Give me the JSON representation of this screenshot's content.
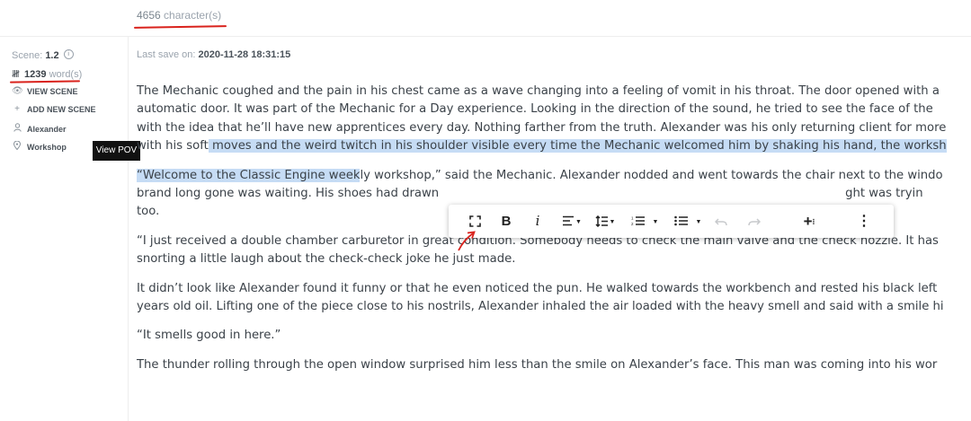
{
  "top": {
    "char_count": "4656",
    "char_label": "character(s)"
  },
  "sidebar": {
    "scene_label": "Scene:",
    "scene_value": "1.2",
    "word_count": "1239",
    "word_label": "word(s)",
    "items": [
      {
        "label": "VIEW SCENE",
        "icon": "eye-icon"
      },
      {
        "label": "ADD NEW SCENE",
        "icon": "plus-icon"
      },
      {
        "label": "Alexander",
        "icon": "user-icon"
      },
      {
        "label": "Workshop",
        "icon": "location-pin-icon"
      }
    ],
    "tooltip": "View POV"
  },
  "editor": {
    "last_save_label": "Last save on:",
    "last_save_value": "2020-11-28 18:31:15",
    "p1": {
      "l1": " The Mechanic coughed and the pain in his chest came as a wave changing into a feeling of vomit in his throat. The door opened with a",
      "l2": "automatic door. It was part of the Mechanic for a Day experience. Looking in the direction of the sound, he tried to see the face of the",
      "l3": "with the idea that he’ll have new apprentices every day. Nothing farther from the truth. Alexander was his only returning client for more",
      "l4a": "with his soft",
      "l4b": " moves and the weird twitch in his shoulder visible every time the Mechanic welcomed him by shaking his hand, the worksh"
    },
    "p2": {
      "l1a": "“Welcome to the Classic Engine week",
      "l1b": "ly workshop,” said the Mechanic. Alexander nodded and went towards the chair next to the windo",
      "l2a": "brand long gone was waiting. His shoes had drawn",
      "l2b": "ght was tryin",
      "l3": "too."
    },
    "p3": {
      "l1": "“I just received a double chamber carburetor in great condition. Somebody needs to check the main valve and the check nozzle. It has",
      "l2": "snorting a little laugh about the check-check joke he just made."
    },
    "p4": {
      "l1": "It didn’t look like Alexander found it funny or that he even noticed the pun. He walked towards the workbench and rested his black left",
      "l2": "years old oil. Lifting one of the piece close to his nostrils, Alexander inhaled the air loaded with the heavy smell and said with a smile hi"
    },
    "p5": {
      "l1": "“It smells good in here.”"
    },
    "p6": {
      "l1": "The thunder rolling through the open window surprised him less than the smile on Alexander’s face. This man was coming into his wor"
    }
  },
  "toolbar": {
    "fullscreen_icon": "fullscreen-icon",
    "bold": "B",
    "italic": "i",
    "align_icon": "align-left-icon",
    "line_height_icon": "line-height-icon",
    "numbered_list_icon": "numbered-list-icon",
    "bullet_list_icon": "bullet-list-icon",
    "undo_icon": "undo-icon",
    "redo_icon": "redo-icon",
    "insert_icon": "insert-plus-icon",
    "more_icon": "more-vertical-icon"
  },
  "colors": {
    "highlight": "#c6dcf5",
    "annotation_red": "#d9221c",
    "muted": "#9aa3ad",
    "text": "#3b4249"
  }
}
